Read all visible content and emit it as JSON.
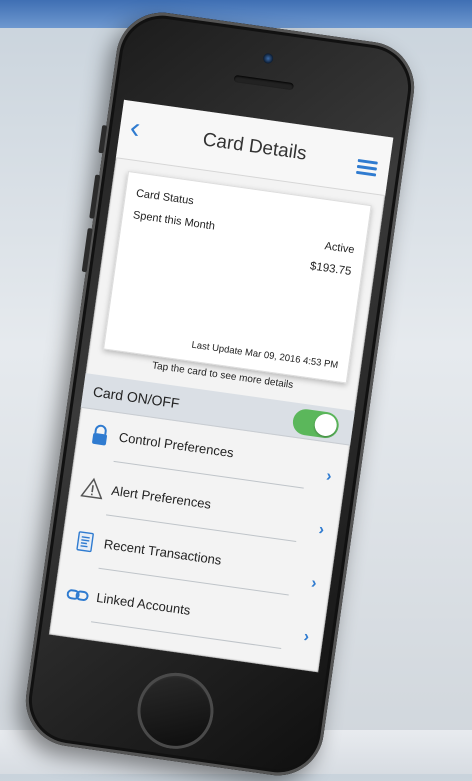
{
  "header": {
    "back_icon": "chevron-left-icon",
    "title": "Card Details",
    "menu_icon": "hamburger-menu-icon"
  },
  "card": {
    "status_label": "Card Status",
    "status_value": "Active",
    "spent_label": "Spent this Month",
    "spent_value": "$193.75",
    "last_update": "Last Update Mar 09, 2016 4:53 PM"
  },
  "tap_hint": "Tap the card to see more details",
  "card_toggle": {
    "label": "Card ON/OFF",
    "on": true,
    "color": "#5bb75b"
  },
  "menu_items": [
    {
      "label": "Control Preferences",
      "icon": "lock-icon"
    },
    {
      "label": "Alert Preferences",
      "icon": "warning-triangle-icon"
    },
    {
      "label": "Recent Transactions",
      "icon": "receipt-icon"
    },
    {
      "label": "Linked Accounts",
      "icon": "link-icon"
    }
  ],
  "colors": {
    "accent": "#2f7bd0",
    "toggle_on": "#5bb75b"
  }
}
